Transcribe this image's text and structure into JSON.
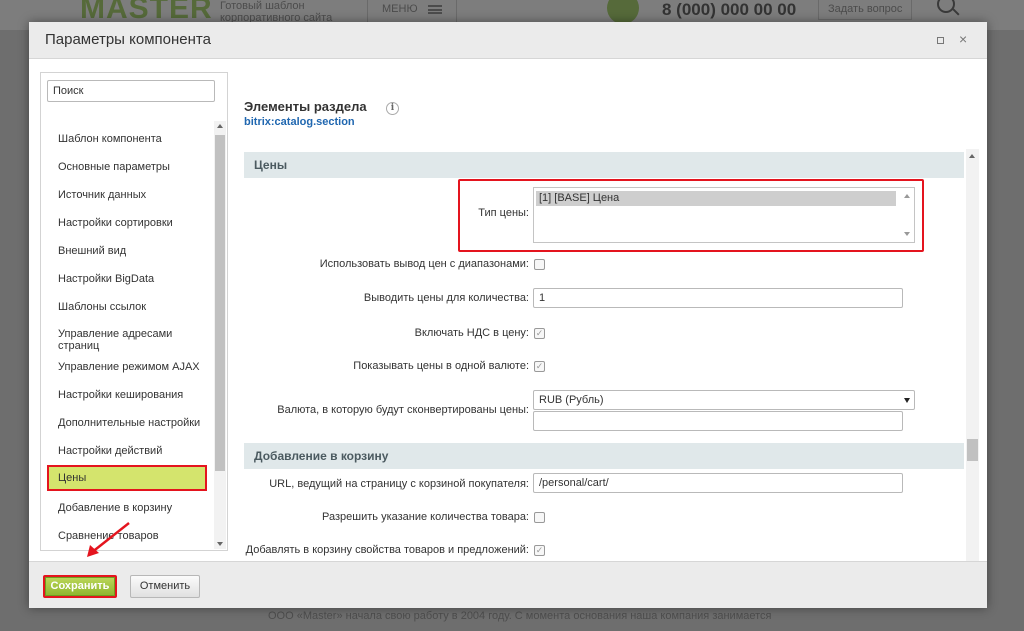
{
  "background_site": {
    "logo": "MASTER",
    "tagline": "Готовый шаблон корпоративного сайта",
    "menu_label": "МЕНЮ",
    "phone": "8 (000) 000 00 00",
    "ask_button": "Задать вопрос",
    "footer_text": "ООО «Master» начала свою работу в 2004 году. С момента основания наша компания занимается"
  },
  "dialog": {
    "title": "Параметры компонента",
    "maximize_icon": "maximize-icon",
    "close_icon": "close-icon",
    "close_glyph": "×"
  },
  "sidebar": {
    "search_placeholder": "Поиск",
    "items": [
      {
        "label": "Шаблон компонента"
      },
      {
        "label": "Основные параметры"
      },
      {
        "label": "Источник данных"
      },
      {
        "label": "Настройки сортировки"
      },
      {
        "label": "Внешний вид"
      },
      {
        "label": "Настройки BigData"
      },
      {
        "label": "Шаблоны ссылок"
      },
      {
        "label": "Управление адресами страниц"
      },
      {
        "label": "Управление режимом AJAX"
      },
      {
        "label": "Настройки кеширования"
      },
      {
        "label": "Дополнительные настройки"
      },
      {
        "label": "Настройки действий"
      },
      {
        "label": "Цены",
        "active": true
      },
      {
        "label": "Добавление в корзину"
      },
      {
        "label": "Сравнение товаров"
      }
    ]
  },
  "component": {
    "title": "Элементы раздела",
    "code": "bitrix:catalog.section",
    "info_icon": "info-icon",
    "info_glyph": "i"
  },
  "sections": {
    "prices": {
      "title": "Цены",
      "price_type_label": "Тип цены:",
      "price_type_option": "[1] [BASE] Цена",
      "use_ranges_label": "Использовать вывод цен с диапазонами:",
      "use_ranges_checked": false,
      "quantity_label": "Выводить цены для количества:",
      "quantity_value": "1",
      "vat_label": "Включать НДС в цену:",
      "vat_checked": true,
      "one_currency_label": "Показывать цены в одной валюте:",
      "one_currency_checked": true,
      "currency_label": "Валюта, в которую будут сконвертированы цены:",
      "currency_value": "RUB (Рубль)",
      "currency_extra_value": ""
    },
    "basket": {
      "title": "Добавление в корзину",
      "basket_url_label": "URL, ведущий на страницу с корзиной покупателя:",
      "basket_url_value": "/personal/cart/",
      "allow_quantity_label": "Разрешить указание количества товара:",
      "allow_quantity_checked": false,
      "add_props_label": "Добавлять в корзину свойства товаров и предложений:",
      "add_props_checked": true
    }
  },
  "footer": {
    "save_label": "Сохранить",
    "cancel_label": "Отменить"
  },
  "colors": {
    "highlight_red": "#e4141e",
    "active_item": "#d4e46d",
    "save_green": "#9bc33b",
    "section_bg": "#e0e8ea",
    "link_blue": "#2067b0"
  }
}
